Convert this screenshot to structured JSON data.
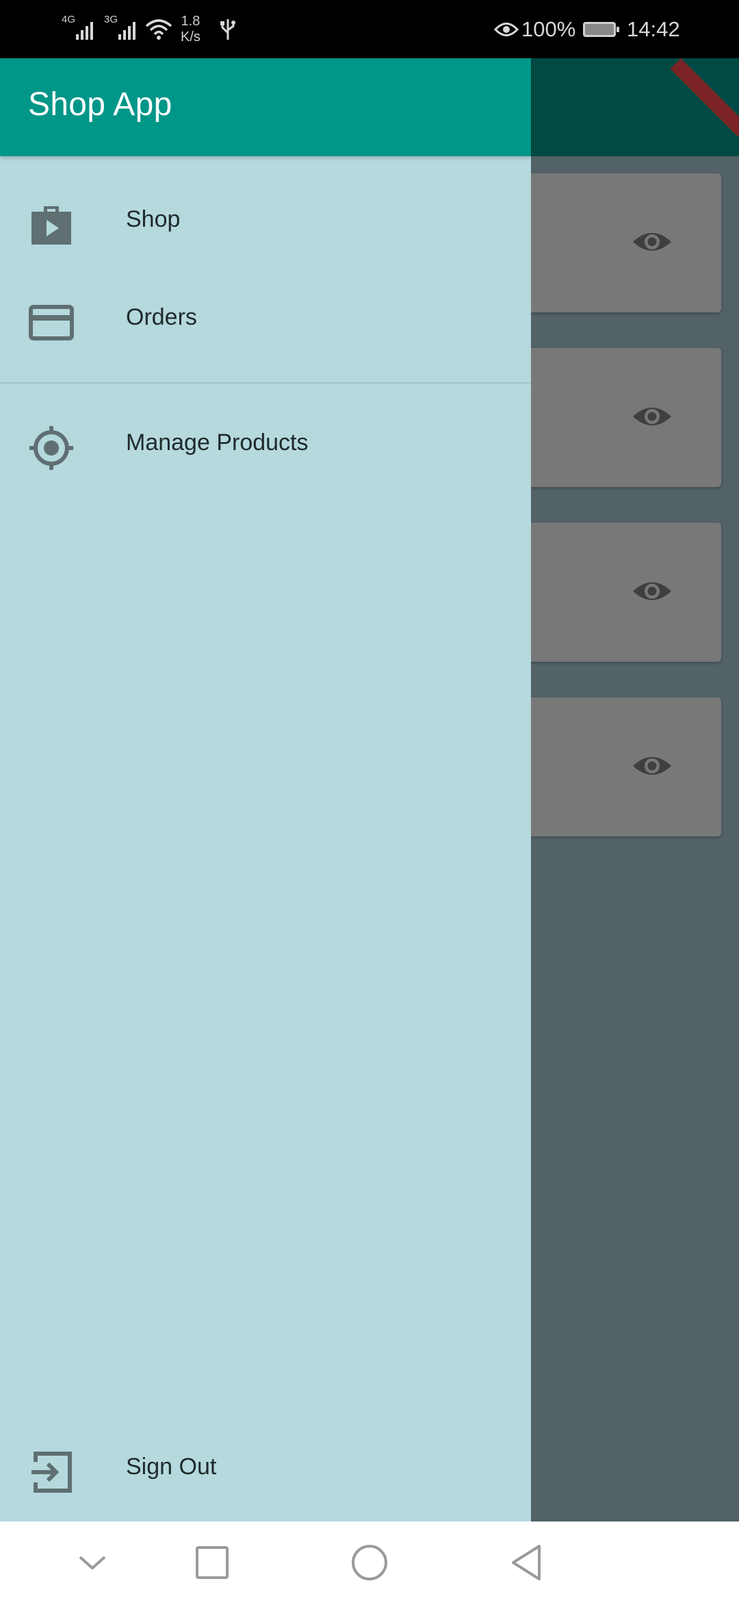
{
  "status_bar": {
    "network_1": "4G",
    "network_2": "3G",
    "speed_value": "1.8",
    "speed_unit": "K/s",
    "battery": "100%",
    "time": "14:42",
    "icons": [
      "signal-4g-icon",
      "signal-3g-icon",
      "wifi-icon",
      "usb-icon",
      "eye-comfort-icon",
      "battery-charging-icon"
    ]
  },
  "drawer": {
    "title": "Shop App",
    "items": [
      {
        "label": "Shop",
        "icon": "shop-icon"
      },
      {
        "label": "Orders",
        "icon": "payment-card-icon"
      },
      {
        "label": "Manage Products",
        "icon": "gps-fixed-icon"
      }
    ],
    "sign_out": {
      "label": "Sign Out",
      "icon": "exit-icon"
    }
  },
  "background_app": {
    "cards": 4,
    "card_icon": "eye-icon"
  },
  "nav_bar": {
    "buttons": [
      "hide-keyboard-icon",
      "recents-icon",
      "home-icon",
      "back-icon"
    ]
  },
  "colors": {
    "app_bar": "#009688",
    "drawer_bg": "#b5d9dd",
    "icon": "#5f6f72",
    "scrim": "#526267"
  }
}
